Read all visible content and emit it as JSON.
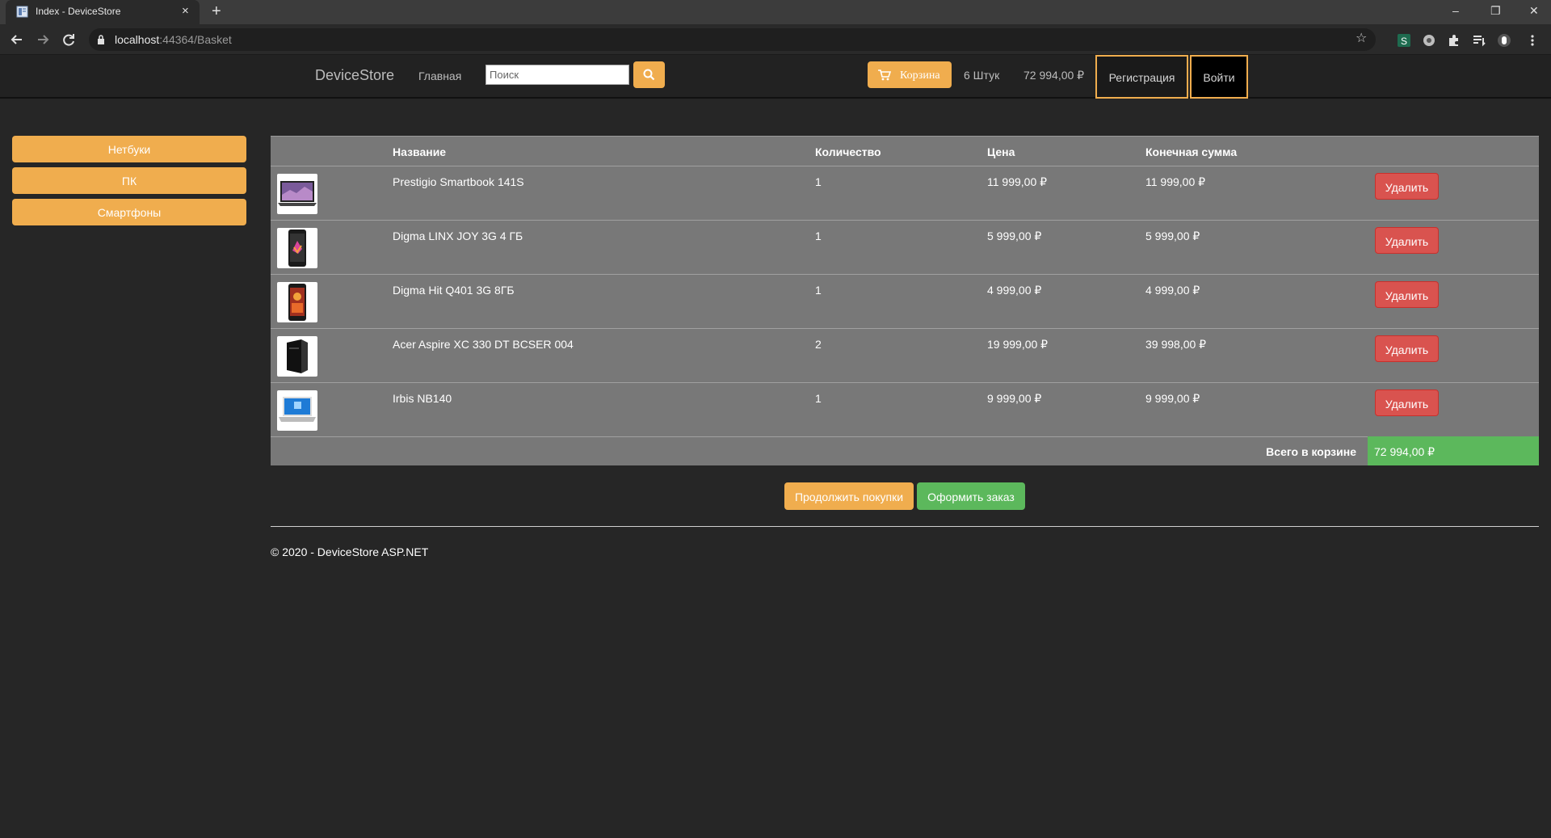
{
  "browser": {
    "tab_title": "Index - DeviceStore",
    "tab_close": "×",
    "new_tab": "+",
    "url_host": "localhost",
    "url_rest": ":44364/Basket",
    "window_minimize": "–",
    "window_restore": "❐",
    "window_close": "✕",
    "star": "☆"
  },
  "header": {
    "brand": "DeviceStore",
    "home_link": "Главная",
    "search_placeholder": "Поиск",
    "search_value": "",
    "cart_label": "Корзина",
    "cart_count": "6 Штук",
    "cart_total": "72 994,00 ₽",
    "register_label": "Регистрация",
    "login_label": "Войти"
  },
  "sidebar": {
    "categories": [
      {
        "label": "Нетбуки"
      },
      {
        "label": "ПК"
      },
      {
        "label": "Смартфоны"
      }
    ]
  },
  "basket": {
    "columns": {
      "name": "Название",
      "quantity": "Количество",
      "price": "Цена",
      "total": "Конечная сумма"
    },
    "items": [
      {
        "name": "Prestigio Smartbook 141S",
        "quantity": "1",
        "price": "11 999,00 ₽",
        "total": "11 999,00 ₽",
        "image": "netbook",
        "delete_label": "Удалить"
      },
      {
        "name": "Digma LINX JOY 3G 4 ГБ",
        "quantity": "1",
        "price": "5 999,00 ₽",
        "total": "5 999,00 ₽",
        "image": "smartphone",
        "delete_label": "Удалить"
      },
      {
        "name": "Digma Hit Q401 3G 8ГБ",
        "quantity": "1",
        "price": "4 999,00 ₽",
        "total": "4 999,00 ₽",
        "image": "smartphone",
        "delete_label": "Удалить"
      },
      {
        "name": "Acer Aspire XC 330 DT BCSER 004",
        "quantity": "2",
        "price": "19 999,00 ₽",
        "total": "39 998,00 ₽",
        "image": "pc-tower",
        "delete_label": "Удалить"
      },
      {
        "name": "Irbis NB140",
        "quantity": "1",
        "price": "9 999,00 ₽",
        "total": "9 999,00 ₽",
        "image": "netbook",
        "delete_label": "Удалить"
      }
    ],
    "total_label": "Всего в корзине",
    "total_value": "72 994,00 ₽",
    "continue_label": "Продолжить покупки",
    "order_label": "Оформить заказ"
  },
  "footer": {
    "text": "© 2020 - DeviceStore ASP.NET"
  },
  "colors": {
    "accent": "#f0ad4e",
    "danger": "#d9534f",
    "success": "#5cb85c",
    "table_bg": "#787878",
    "page_bg": "#262626"
  }
}
